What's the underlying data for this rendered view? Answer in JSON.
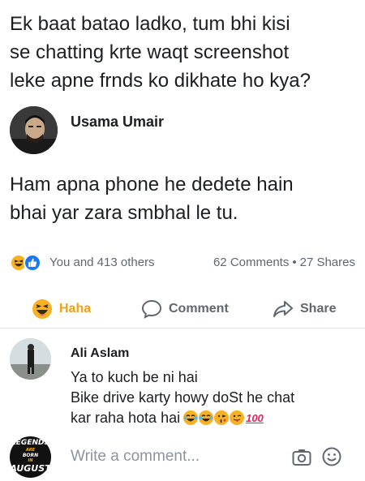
{
  "post": {
    "question_lines": [
      "Ek baat batao ladko, tum bhi kisi",
      "se chatting krte waqt screenshot",
      "leke apne frnds ko dikhate ho kya?"
    ]
  },
  "answer": {
    "author": "Usama Umair",
    "text_lines": [
      "Ham apna phone he dedete hain",
      "bhai yar zara smbhal le tu."
    ]
  },
  "stats": {
    "reactions_text": "You and 413 others",
    "comments": "62 Comments",
    "separator": "•",
    "shares": "27 Shares"
  },
  "actions": {
    "haha_label": "Haha",
    "comment_label": "Comment",
    "share_label": "Share"
  },
  "comment": {
    "author": "Ali Aslam",
    "line1": "Ya to kuch be ni hai",
    "line2": "Bike drive karty howy doSt he chat",
    "line3": "kar raha hota hai",
    "badge": "100"
  },
  "composer": {
    "placeholder": "Write a comment...",
    "avatar_logo": [
      "LEGENDS",
      "ARE",
      "BORN",
      "IN",
      "AUGUST"
    ]
  },
  "colors": {
    "haha": "#f0a016",
    "like": "#1877f2",
    "muted": "#606770"
  }
}
